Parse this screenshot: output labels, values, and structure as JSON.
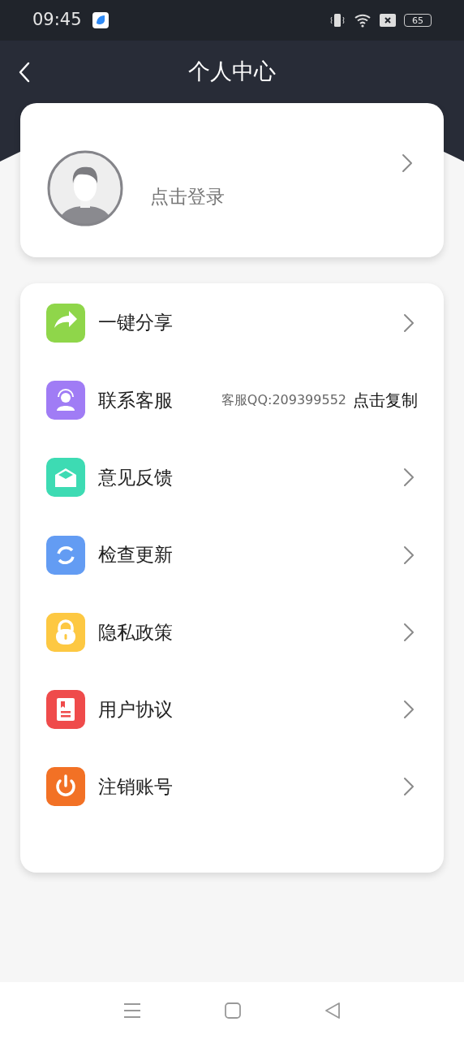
{
  "status_bar": {
    "time": "09:45",
    "battery": "65"
  },
  "header": {
    "title": "个人中心"
  },
  "profile": {
    "label": "点击登录"
  },
  "menu": [
    {
      "kind": "link",
      "label": "一键分享",
      "color": "#8fd64a"
    },
    {
      "kind": "copy",
      "label": "联系客服",
      "info": "客服QQ:209399552",
      "action": "点击复制",
      "color": "#a07cf5"
    },
    {
      "kind": "link",
      "label": "意见反馈",
      "color": "#3ddbb3"
    },
    {
      "kind": "link",
      "label": "检查更新",
      "color": "#639cf3"
    },
    {
      "kind": "link",
      "label": "隐私政策",
      "color": "#fdc842"
    },
    {
      "kind": "link",
      "label": "用户协议",
      "color": "#ef4b4b"
    },
    {
      "kind": "link",
      "label": "注销账号",
      "color": "#f27125"
    }
  ]
}
